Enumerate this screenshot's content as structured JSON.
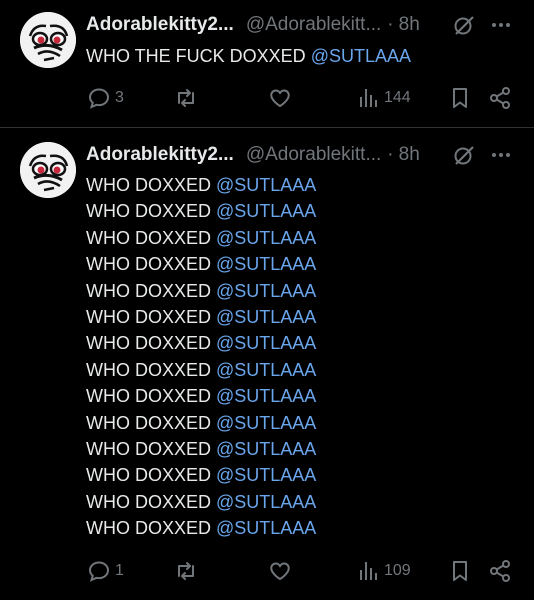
{
  "tweets": [
    {
      "author_name": "Adorablekitty2...",
      "handle": "@Adorablekitt...",
      "separator": "·",
      "time": "8h",
      "lines": [
        {
          "text": "WHO THE FUCK DOXXED ",
          "mention": "@SUTLAAA"
        }
      ],
      "replies": "3",
      "views": "144"
    },
    {
      "author_name": "Adorablekitty2...",
      "handle": "@Adorablekitt...",
      "separator": "·",
      "time": "8h",
      "lines": [
        {
          "text": "WHO DOXXED ",
          "mention": "@SUTLAAA"
        },
        {
          "text": "WHO DOXXED ",
          "mention": "@SUTLAAA"
        },
        {
          "text": "WHO DOXXED ",
          "mention": "@SUTLAAA"
        },
        {
          "text": "WHO DOXXED ",
          "mention": "@SUTLAAA"
        },
        {
          "text": "WHO DOXXED ",
          "mention": "@SUTLAAA"
        },
        {
          "text": "WHO DOXXED ",
          "mention": "@SUTLAAA"
        },
        {
          "text": "WHO DOXXED ",
          "mention": "@SUTLAAA"
        },
        {
          "text": "WHO DOXXED ",
          "mention": "@SUTLAAA"
        },
        {
          "text": "WHO DOXXED ",
          "mention": "@SUTLAAA"
        },
        {
          "text": "WHO DOXXED ",
          "mention": "@SUTLAAA"
        },
        {
          "text": "WHO DOXXED ",
          "mention": "@SUTLAAA"
        },
        {
          "text": "WHO DOXXED ",
          "mention": "@SUTLAAA"
        },
        {
          "text": "WHO DOXXED ",
          "mention": "@SUTLAAA"
        },
        {
          "text": "WHO DOXXED ",
          "mention": "@SUTLAAA"
        }
      ],
      "replies": "1",
      "views": "109"
    }
  ],
  "icons": {
    "avatar": "crying-cartoon-face-avatar",
    "grok": "grok-slash-circle-icon",
    "more": "more-dots-icon",
    "reply": "reply-bubble-icon",
    "repost": "repost-arrows-icon",
    "like": "heart-icon",
    "views": "views-bar-chart-icon",
    "bookmark": "bookmark-icon",
    "share": "share-nodes-icon"
  },
  "colors": {
    "background": "#000000",
    "text": "#e7e9ea",
    "muted": "#71767b",
    "mention": "#6aa6ec",
    "divider": "#2f3336"
  }
}
